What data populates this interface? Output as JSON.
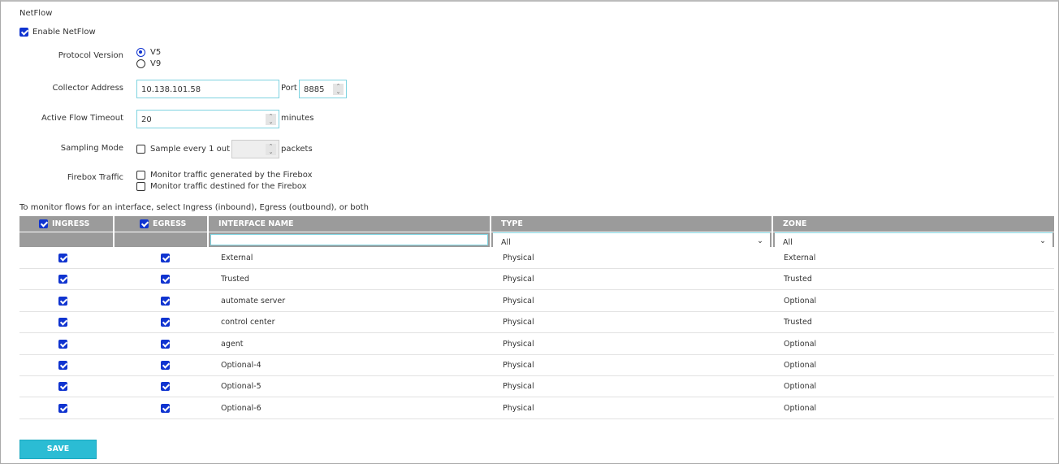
{
  "section_title": "NetFlow",
  "enable_label": "Enable NetFlow",
  "protocol": {
    "label": "Protocol Version",
    "options": [
      "V5",
      "V9"
    ],
    "selected": "V5"
  },
  "collector": {
    "label": "Collector Address",
    "value": "10.138.101.58",
    "port_label": "Port",
    "port_value": "8885"
  },
  "timeout": {
    "label": "Active Flow Timeout",
    "value": "20",
    "unit": "minutes"
  },
  "sampling": {
    "label": "Sampling Mode",
    "text": "Sample every 1 out of",
    "value": "",
    "unit": "packets"
  },
  "firebox": {
    "label": "Firebox Traffic",
    "options": [
      "Monitor traffic generated by the Firebox",
      "Monitor traffic destined for the Firebox"
    ]
  },
  "table_hint": "To monitor flows for an interface, select Ingress (inbound), Egress (outbound), or both",
  "table": {
    "headers": [
      "INGRESS",
      "EGRESS",
      "INTERFACE NAME",
      "TYPE",
      "ZONE"
    ],
    "filters": {
      "name": "",
      "type": "All",
      "zone": "All"
    },
    "rows": [
      {
        "name": "External",
        "type": "Physical",
        "zone": "External"
      },
      {
        "name": "Trusted",
        "type": "Physical",
        "zone": "Trusted"
      },
      {
        "name": "automate server",
        "type": "Physical",
        "zone": "Optional"
      },
      {
        "name": "control center",
        "type": "Physical",
        "zone": "Trusted"
      },
      {
        "name": "agent",
        "type": "Physical",
        "zone": "Optional"
      },
      {
        "name": "Optional-4",
        "type": "Physical",
        "zone": "Optional"
      },
      {
        "name": "Optional-5",
        "type": "Physical",
        "zone": "Optional"
      },
      {
        "name": "Optional-6",
        "type": "Physical",
        "zone": "Optional"
      }
    ]
  },
  "save_label": "SAVE"
}
